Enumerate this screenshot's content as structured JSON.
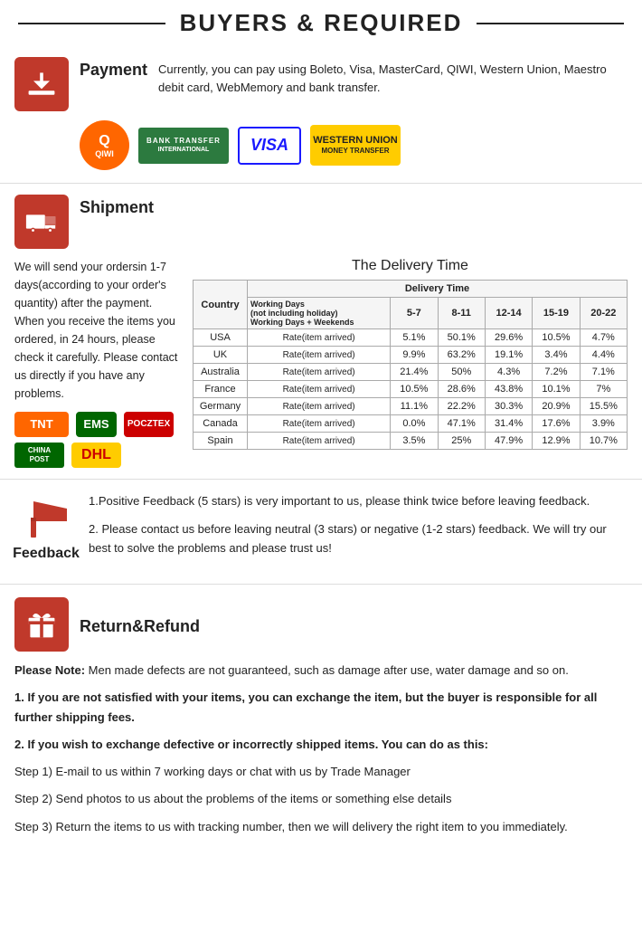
{
  "header": {
    "title": "BUYERS & REQUIRED"
  },
  "payment": {
    "section_label": "Payment",
    "description": "Currently, you can pay using Boleto, Visa, MasterCard, QIWI, Western Union, Maestro  debit card, WebMemory and bank transfer.",
    "logos": [
      {
        "name": "QIWI",
        "type": "qiwi"
      },
      {
        "name": "BANK TRANSFER INTERNATIONAL",
        "type": "bank"
      },
      {
        "name": "VISA",
        "type": "visa"
      },
      {
        "name": "WESTERN UNION MONEY TRANSFER",
        "type": "wu"
      }
    ]
  },
  "shipment": {
    "section_label": "Shipment",
    "body_text": "We will send your ordersin 1-7 days(according to your order's quantity) after the payment. When you receive the items you ordered, in 24  hours, please check it carefully. Please  contact us directly if you have any problems.",
    "delivery_title": "The Delivery Time",
    "table": {
      "col_header": "Country",
      "col_delivery": "Delivery Time",
      "sub_headers": [
        "Working Days\n(not including holiday)\nWorking Days + Weekends",
        "5-7",
        "8-11",
        "12-14",
        "15-19",
        "20-22"
      ],
      "rows": [
        {
          "country": "USA",
          "note": "Rate(item arrived)",
          "c1": "5.1%",
          "c2": "50.1%",
          "c3": "29.6%",
          "c4": "10.5%",
          "c5": "4.7%"
        },
        {
          "country": "UK",
          "note": "Rate(item arrived)",
          "c1": "9.9%",
          "c2": "63.2%",
          "c3": "19.1%",
          "c4": "3.4%",
          "c5": "4.4%"
        },
        {
          "country": "Australia",
          "note": "Rate(item arrived)",
          "c1": "21.4%",
          "c2": "50%",
          "c3": "4.3%",
          "c4": "7.2%",
          "c5": "7.1%"
        },
        {
          "country": "France",
          "note": "Rate(item arrived)",
          "c1": "10.5%",
          "c2": "28.6%",
          "c3": "43.8%",
          "c4": "10.1%",
          "c5": "7%"
        },
        {
          "country": "Germany",
          "note": "Rate(item arrived)",
          "c1": "11.1%",
          "c2": "22.2%",
          "c3": "30.3%",
          "c4": "20.9%",
          "c5": "15.5%"
        },
        {
          "country": "Canada",
          "note": "Rate(item arrived)",
          "c1": "0.0%",
          "c2": "47.1%",
          "c3": "31.4%",
          "c4": "17.6%",
          "c5": "3.9%"
        },
        {
          "country": "Spain",
          "note": "Rate(item arrived)",
          "c1": "3.5%",
          "c2": "25%",
          "c3": "47.9%",
          "c4": "12.9%",
          "c5": "10.7%"
        }
      ]
    },
    "couriers": [
      "TNT",
      "EMS",
      "POCZTEX",
      "CHINA POST",
      "DHL"
    ]
  },
  "feedback": {
    "section_label": "Feedback",
    "point1": "1.Positive Feedback (5 stars) is very important to us, please think twice before leaving feedback.",
    "point2": "2. Please contact us before leaving neutral (3 stars) or negative  (1-2 stars) feedback. We will try our best to solve the problems and please trust us!"
  },
  "refund": {
    "section_label": "Return&Refund",
    "note_label": "Please Note:",
    "note_text": " Men made defects are not guaranteed, such as damage after use, water damage and so on.",
    "point1": "1. If you are not satisfied with your items, you can exchange the item, but the buyer is responsible for all further shipping fees.",
    "point2_label": "2. If you wish to exchange defective or incorrectly shipped items. You can do as this:",
    "steps": [
      "Step 1) E-mail to us within 7 working days or chat with us by Trade Manager",
      "Step 2) Send photos to us about the problems of the items or something else details",
      "Step 3) Return the items to us with tracking number, then we will delivery the right item to you immediately."
    ]
  }
}
